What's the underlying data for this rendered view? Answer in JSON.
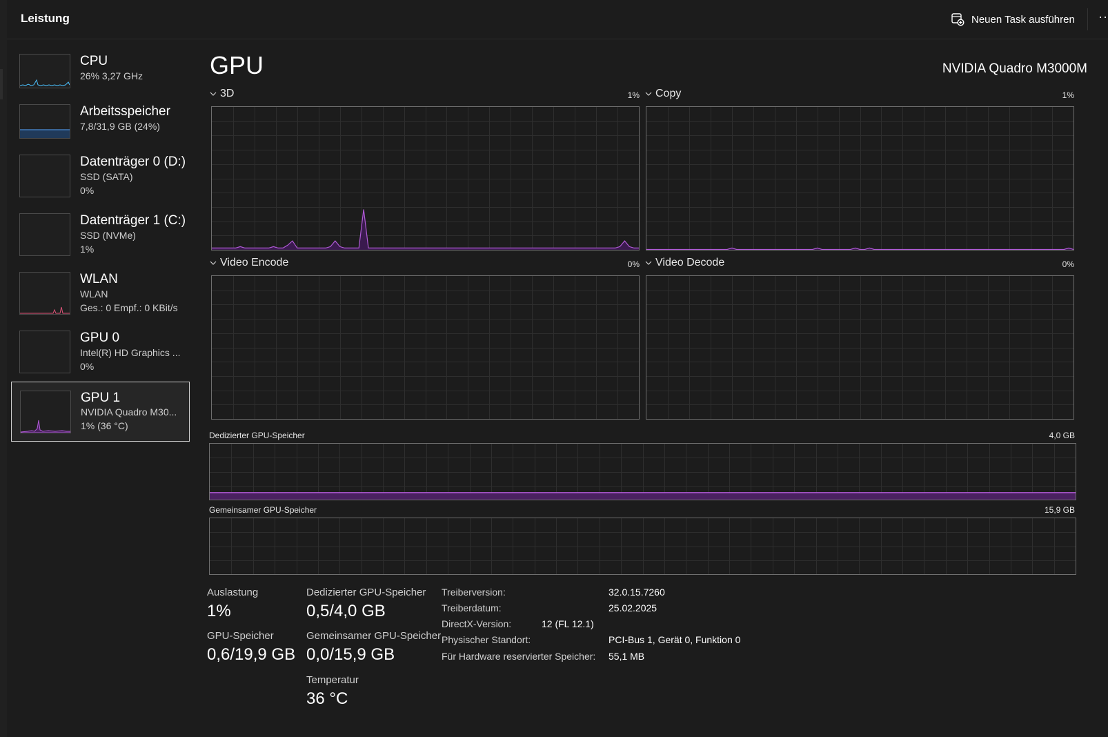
{
  "header": {
    "title": "Leistung",
    "new_task_label": "Neuen Task ausführen",
    "more_label": "···"
  },
  "sidebar": {
    "items": [
      {
        "name": "CPU",
        "line1": "26%  3,27 GHz",
        "line2": "",
        "color": "#4cc2ff",
        "selected": false
      },
      {
        "name": "Arbeitsspeicher",
        "line1": "7,8/31,9 GB (24%)",
        "line2": "",
        "color": "#4a8cd6",
        "selected": false
      },
      {
        "name": "Datenträger 0 (D:)",
        "line1": "SSD (SATA)",
        "line2": "0%",
        "color": "#6ccf55",
        "selected": false
      },
      {
        "name": "Datenträger 1 (C:)",
        "line1": "SSD (NVMe)",
        "line2": "1%",
        "color": "#6ccf55",
        "selected": false
      },
      {
        "name": "WLAN",
        "line1": "WLAN",
        "line2": "Ges.: 0  Empf.: 0 KBit/s",
        "color": "#e0557a",
        "selected": false
      },
      {
        "name": "GPU 0",
        "line1": "Intel(R) HD Graphics ...",
        "line2": "0%",
        "color": "#b05ad6",
        "selected": false
      },
      {
        "name": "GPU 1",
        "line1": "NVIDIA Quadro M30...",
        "line2": "1%  (36 °C)",
        "color": "#b05ad6",
        "selected": true
      }
    ]
  },
  "main": {
    "title": "GPU",
    "device": "NVIDIA Quadro M3000M"
  },
  "engines": [
    {
      "label": "3D",
      "value": "1%",
      "series": [
        1,
        1,
        1,
        1,
        1,
        1,
        2,
        1,
        1,
        1,
        1,
        1,
        1,
        2,
        1,
        1,
        3,
        6,
        1,
        1,
        1,
        1,
        1,
        1,
        1,
        2,
        6,
        2,
        1,
        1,
        1,
        1,
        28,
        1,
        1,
        1,
        1,
        1,
        1,
        1,
        1,
        1,
        1,
        1,
        1,
        1,
        1,
        1,
        1,
        1,
        1,
        1,
        1,
        1,
        1,
        1,
        1,
        1,
        1,
        1,
        1,
        1,
        1,
        1,
        1,
        1,
        1,
        1,
        1,
        1,
        1,
        1,
        1,
        1,
        1,
        1,
        1,
        1,
        1,
        1,
        1,
        1,
        1,
        1,
        1,
        1,
        2,
        6,
        2,
        1,
        1
      ]
    },
    {
      "label": "Copy",
      "value": "1%",
      "series": [
        0,
        0,
        0,
        0,
        0,
        0,
        0,
        0,
        0,
        0,
        0,
        0,
        0,
        0,
        0,
        0,
        0,
        0,
        1,
        0,
        0,
        0,
        0,
        0,
        0,
        0,
        0,
        0,
        0,
        0,
        0,
        0,
        0,
        0,
        0,
        0,
        1,
        0,
        0,
        0,
        0,
        0,
        0,
        0,
        1,
        0,
        0,
        1,
        0,
        0,
        0,
        0,
        0,
        0,
        0,
        0,
        0,
        0,
        0,
        0,
        0,
        0,
        0,
        0,
        0,
        0,
        0,
        0,
        0,
        0,
        0,
        0,
        0,
        0,
        0,
        0,
        0,
        0,
        0,
        0,
        0,
        0,
        0,
        0,
        0,
        0,
        0,
        0,
        0,
        1,
        0
      ]
    },
    {
      "label": "Video Encode",
      "value": "0%",
      "series": []
    },
    {
      "label": "Video Decode",
      "value": "0%",
      "series": []
    }
  ],
  "memory_charts": [
    {
      "label": "Dedizierter GPU-Speicher",
      "max": "4,0 GB",
      "fill_fraction": 0.125
    },
    {
      "label": "Gemeinsamer GPU-Speicher",
      "max": "15,9 GB",
      "fill_fraction": 0
    }
  ],
  "stats": {
    "util_label": "Auslastung",
    "util_value": "1%",
    "gpu_mem_label": "GPU-Speicher",
    "gpu_mem_value": "0,6/19,9 GB",
    "dedicated_label": "Dedizierter GPU-Speicher",
    "dedicated_value": "0,5/4,0 GB",
    "shared_label": "Gemeinsamer GPU-Speicher",
    "shared_value": "0,0/15,9 GB",
    "temp_label": "Temperatur",
    "temp_value": "36 °C"
  },
  "info": [
    {
      "label": "Treiberversion:",
      "value": "32.0.15.7260"
    },
    {
      "label": "Treiberdatum:",
      "value": "25.02.2025"
    },
    {
      "label": "DirectX-Version:",
      "value": "12 (FL 12.1)"
    },
    {
      "label": "Physischer Standort:",
      "value": "PCI-Bus 1, Gerät 0, Funktion 0"
    },
    {
      "label": "Für Hardware reservierter Speicher:",
      "value": "55,1 MB"
    }
  ],
  "colors": {
    "accent_gpu": "#b05ad6",
    "grid": "#2e2e2e",
    "panel_border": "#6f6f6f"
  }
}
